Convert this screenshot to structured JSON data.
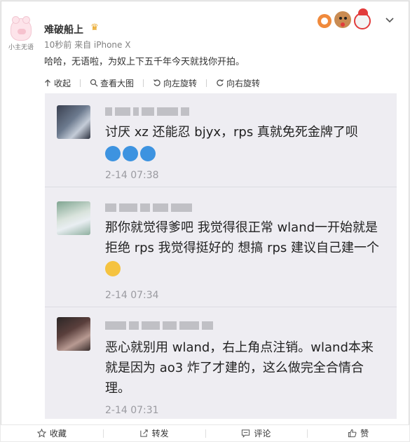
{
  "post": {
    "username": "难破船上",
    "meta": "10秒前 来自 iPhone X",
    "text": "哈哈，无语啦，为奴上下五千年今天就找你开拍。",
    "avatar_caption": "小主无语"
  },
  "toolbar": {
    "collapse": "收起",
    "view_large": "查看大图",
    "rotate_left": "向左旋转",
    "rotate_right": "向右旋转"
  },
  "comments": [
    {
      "text": "讨厌 xz 还能忍 bjyx，rps 真就免死金牌了呗",
      "time": "2-14 07:38"
    },
    {
      "text": "那你就觉得爹吧 我觉得很正常 wland一开始就是拒绝 rps 我觉得挺好的 想搞 rps 建议自己建一个",
      "time": "2-14 07:34"
    },
    {
      "text": "恶心就别用 wland，右上角点注销。wland本来就是因为 ao3 炸了才建的，这么做完全合情合理。",
      "time": "2-14 07:31"
    }
  ],
  "actions": {
    "favorite": "收藏",
    "repost": "转发",
    "comment": "评论",
    "like": "赞"
  },
  "icons": [
    "crown-icon",
    "chevron-down-icon",
    "collapse-icon",
    "zoom-icon",
    "rotate-left-icon",
    "rotate-right-icon",
    "star-icon",
    "repost-icon",
    "comment-icon",
    "thumbs-up-icon"
  ],
  "colors": {
    "accent": "#e8a21b",
    "text": "#333333",
    "meta": "#808080"
  }
}
